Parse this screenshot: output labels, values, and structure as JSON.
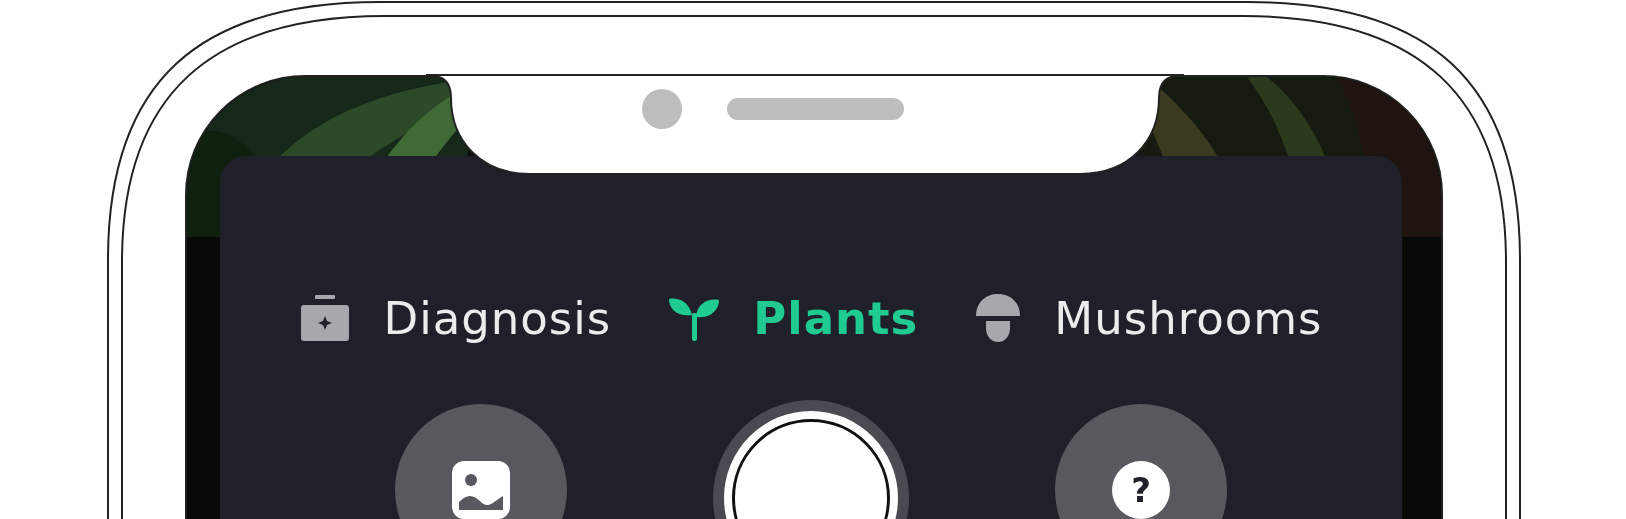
{
  "tabs": [
    {
      "label": "Diagnosis",
      "selected": false
    },
    {
      "label": "Plants",
      "selected": true
    },
    {
      "label": "Mushrooms",
      "selected": false
    }
  ],
  "camera_controls": {
    "help_label": "?"
  }
}
